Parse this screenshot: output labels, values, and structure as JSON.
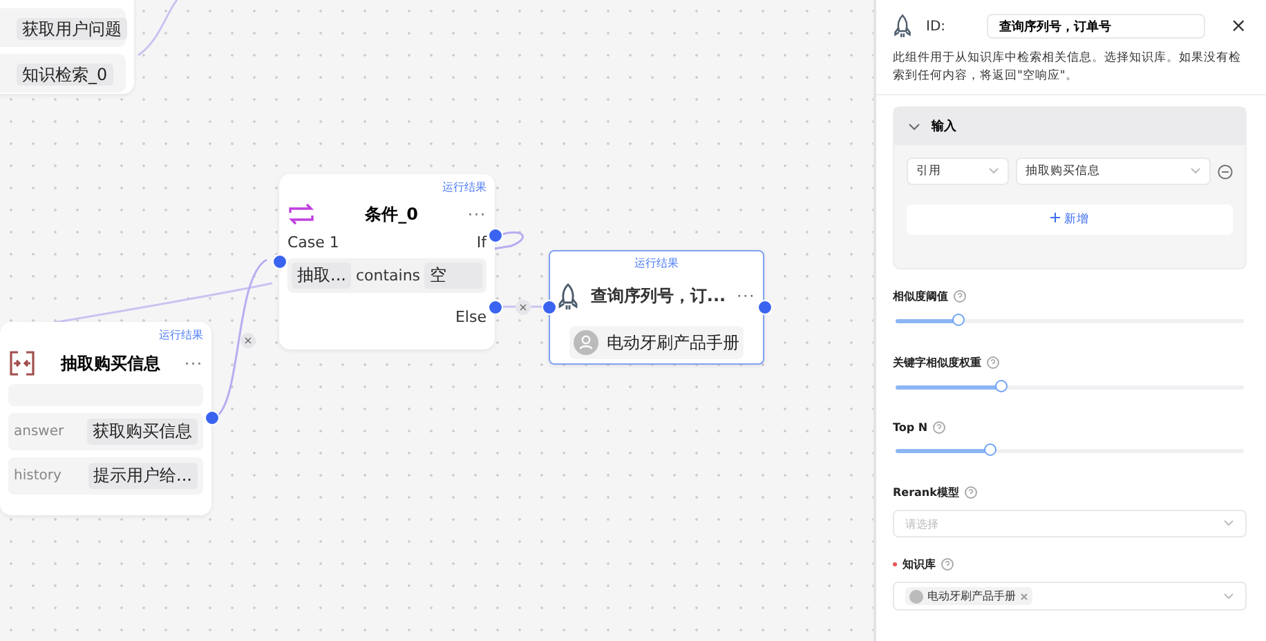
{
  "canvas": {
    "nodes": [
      {
        "kind": "list",
        "rows": [
          "获取用户问题",
          "知识检索_0"
        ]
      },
      {
        "kind": "extract",
        "result_link": "运行结果",
        "title": "抽取购买信息",
        "more": "···",
        "fields": [
          {
            "name": "answer",
            "value": "获取购买信息"
          },
          {
            "name": "history",
            "value": "提示用户给..."
          }
        ]
      },
      {
        "kind": "condition",
        "result_link": "运行结果",
        "title": "条件_0",
        "more": "···",
        "case": "Case 1",
        "if_label": "If",
        "rule": {
          "left": "抽取...",
          "op": "contains",
          "right": "空"
        },
        "else_label": "Else"
      },
      {
        "kind": "retrieval",
        "result_link": "运行结果",
        "title": "查询序列号，订...",
        "more": "···",
        "selected": true,
        "item": "电动牙刷产品手册"
      }
    ],
    "edge_marks": [
      "×",
      "×"
    ]
  },
  "panel": {
    "id_label": "ID:",
    "id_value": "查询序列号，订单号",
    "close": "×",
    "description": "此组件用于从知识库中检索相关信息。选择知识库。如果没有检索到任何内容，将返回\"空响应\"。",
    "input_section": {
      "title": "输入",
      "expanded": true,
      "rows": [
        {
          "type": "引用",
          "source": "抽取购买信息"
        }
      ],
      "add_button": "新增"
    },
    "sliders": [
      {
        "label": "相似度阈值",
        "level": 0.18
      },
      {
        "label": "关键字相似度权重",
        "level": 0.3
      },
      {
        "label": "Top N",
        "level": 0.27
      }
    ],
    "rerank": {
      "label": "Rerank模型",
      "placeholder": "请选择"
    },
    "knowledge_base": {
      "label": "知识库",
      "required": true,
      "tags": [
        "电动牙刷产品手册"
      ]
    }
  }
}
